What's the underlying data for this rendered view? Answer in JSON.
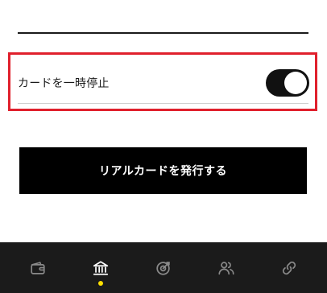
{
  "settings": {
    "pause_card_label": "カードを一時停止",
    "pause_card_enabled": true
  },
  "actions": {
    "issue_real_card_label": "リアルカードを発行する"
  },
  "colors": {
    "highlight": "#e0202c",
    "button_bg": "#000000",
    "nav_bg": "#1b1b1b",
    "active_indicator": "#ffe000"
  },
  "bottom_nav": {
    "items": [
      {
        "icon": "wallet-icon",
        "active": false
      },
      {
        "icon": "bank-icon",
        "active": true
      },
      {
        "icon": "target-icon",
        "active": false
      },
      {
        "icon": "people-icon",
        "active": false
      },
      {
        "icon": "link-icon",
        "active": false
      }
    ]
  }
}
